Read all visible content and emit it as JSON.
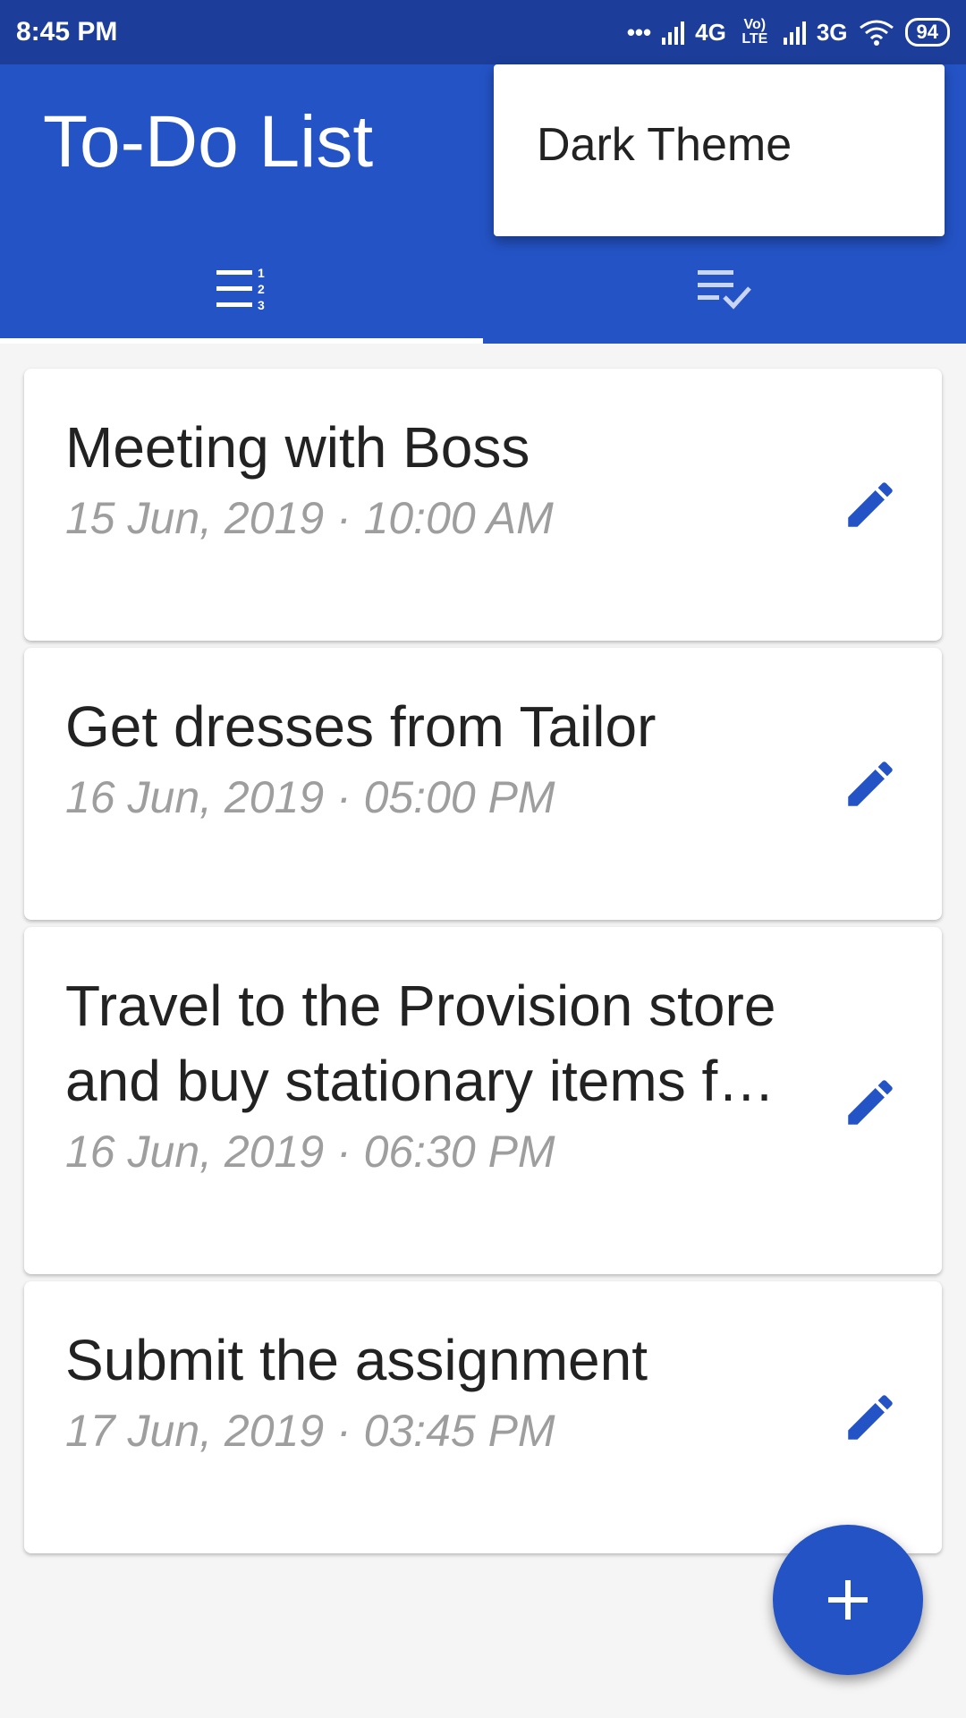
{
  "status_bar": {
    "time": "8:45 PM",
    "network1": "4G",
    "volte": "Vo) LTE",
    "network2": "3G",
    "battery": "94",
    "icons": [
      "more-dots-icon",
      "signal-icon",
      "wifi-icon",
      "battery-icon"
    ]
  },
  "app_bar": {
    "title": "To-Do List",
    "tabs": [
      {
        "icon": "numbered-list-icon",
        "selected": true
      },
      {
        "icon": "checklist-done-icon",
        "selected": false
      }
    ]
  },
  "menu": {
    "items": [
      {
        "label": "Dark Theme"
      }
    ]
  },
  "tasks": [
    {
      "title": "Meeting with Boss",
      "datetime": "15 Jun, 2019 · 10:00 AM",
      "icon": "edit-icon"
    },
    {
      "title": "Get dresses from Tailor",
      "datetime": "16 Jun, 2019 · 05:00 PM",
      "icon": "edit-icon"
    },
    {
      "title": "Travel to the Provision store and buy stationary items f…",
      "datetime": "16 Jun, 2019 · 06:30 PM",
      "icon": "edit-icon"
    },
    {
      "title": "Submit the assignment",
      "datetime": "17 Jun, 2019 · 03:45 PM",
      "icon": "edit-icon"
    }
  ],
  "fab": {
    "icon": "plus-icon"
  },
  "colors": {
    "status_bar": "#1c3e9a",
    "primary": "#2453c6",
    "background": "#f5f5f5",
    "subtitle": "#9e9e9e"
  }
}
